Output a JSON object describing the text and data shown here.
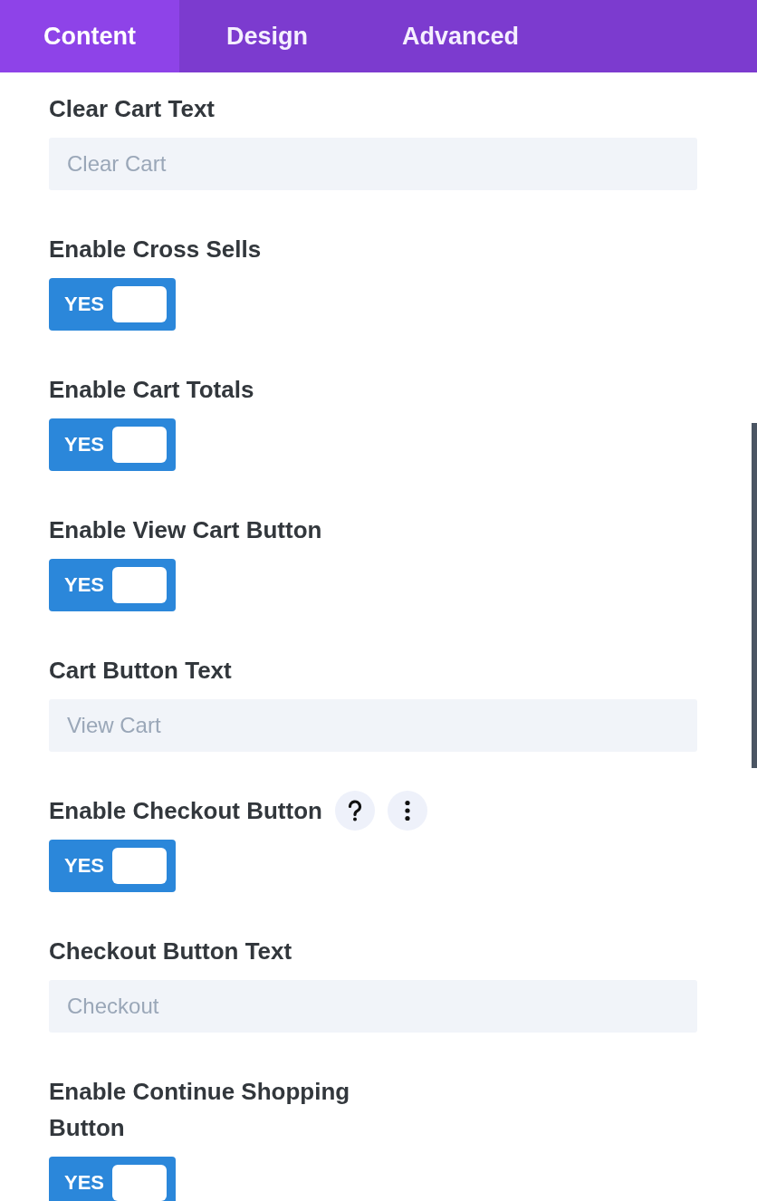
{
  "tabs": [
    {
      "label": "Content",
      "selected": true
    },
    {
      "label": "Design",
      "selected": false
    },
    {
      "label": "Advanced",
      "selected": false
    }
  ],
  "settings": [
    {
      "kind": "text",
      "label": "Clear Cart Text",
      "placeholder": "Clear Cart"
    },
    {
      "kind": "toggle",
      "label": "Enable Cross Sells",
      "on": true,
      "state_label": "YES"
    },
    {
      "kind": "toggle",
      "label": "Enable Cart Totals",
      "on": true,
      "state_label": "YES"
    },
    {
      "kind": "toggle",
      "label": "Enable View Cart Button",
      "on": true,
      "state_label": "YES"
    },
    {
      "kind": "text",
      "label": "Cart Button Text",
      "placeholder": "View Cart"
    },
    {
      "kind": "toggle",
      "label": "Enable Checkout Button",
      "on": true,
      "state_label": "YES",
      "actions": [
        {
          "kind": "help"
        },
        {
          "kind": "more"
        }
      ]
    },
    {
      "kind": "text",
      "label": "Checkout Button Text",
      "placeholder": "Checkout"
    },
    {
      "kind": "toggle",
      "label": "Enable Continue Shopping Button",
      "on": true,
      "state_label": "YES"
    }
  ]
}
